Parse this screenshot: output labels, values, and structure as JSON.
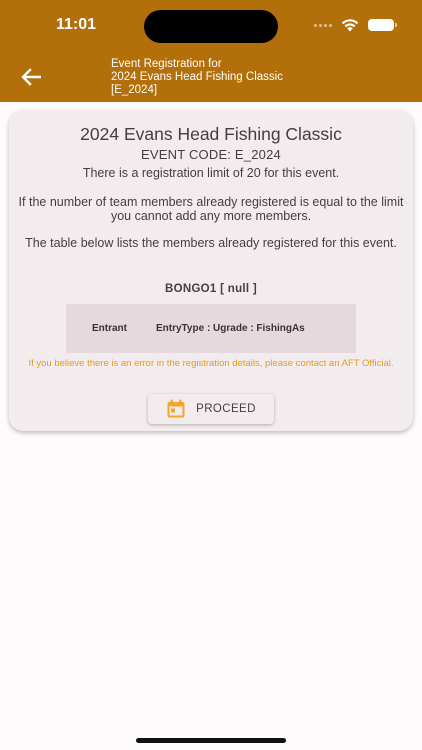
{
  "status_bar": {
    "time": "11:01"
  },
  "header": {
    "title_lines": [
      "Event Registration for",
      "2024 Evans Head Fishing Classic",
      "[E_2024]"
    ]
  },
  "card": {
    "event_title": "2024 Evans Head Fishing Classic",
    "event_code": "EVENT CODE: E_2024",
    "limit_text": "There is a registration limit of 20 for this event.",
    "limit_warning": "If the number of team members already registered is equal to the limit you cannot add any more members.",
    "table_intro": "The table below lists the members already registered for this event.",
    "team_name": "BONGO1 [ null ]",
    "table": {
      "columns": [
        "Entrant",
        "EntryType : Ugrade : FishingAs"
      ]
    },
    "error_note": "If you believe there is an error in the registration details, please contact an AFT Official.",
    "proceed_label": "PROCEED"
  },
  "colors": {
    "header_bg": "#b36f0a",
    "card_bg": "#f3ecee",
    "accent_orange": "#e59b1c",
    "text": "#4a3a42"
  },
  "icons": [
    "back-arrow-icon",
    "calendar-icon",
    "wifi-icon",
    "battery-icon"
  ]
}
